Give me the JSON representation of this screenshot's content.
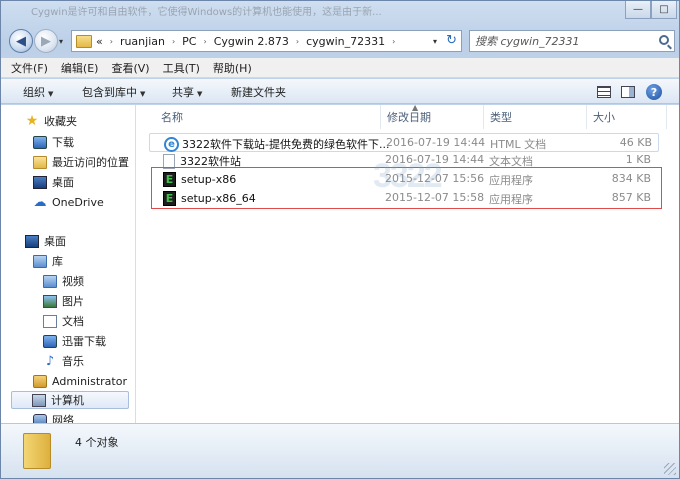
{
  "window": {
    "title_ghost": "Cygwin是许可和自由软件，它使得Windows的计算机也能使用，这是由于新...",
    "minimize_glyph": "—",
    "maximize_glyph": "□"
  },
  "address": {
    "overflow": "«",
    "breadcrumbs": [
      "ruanjian",
      "PC",
      "Cygwin 2.873",
      "cygwin_72331"
    ],
    "separator": "›",
    "dropdown_glyph": "▾",
    "refresh_glyph": "↻"
  },
  "search": {
    "placeholder": "搜索 cygwin_72331"
  },
  "nav_buttons": {
    "back_glyph": "◀",
    "forward_glyph": "▶",
    "history_glyph": "▾"
  },
  "menu": [
    "文件(F)",
    "编辑(E)",
    "查看(V)",
    "工具(T)",
    "帮助(H)"
  ],
  "toolbar": {
    "organize": "组织",
    "include_in_library": "包含到库中",
    "share": "共享",
    "new_folder": "新建文件夹",
    "dropdown_glyph": "▼",
    "help_glyph": "?"
  },
  "navpane": {
    "favorites": "收藏夹",
    "downloads": "下载",
    "recent": "最近访问的位置",
    "desktop_fav": "桌面",
    "onedrive": "OneDrive",
    "desktop": "桌面",
    "libraries": "库",
    "videos": "视频",
    "pictures": "图片",
    "documents": "文档",
    "thunder": "迅雷下载",
    "music": "音乐",
    "administrator": "Administrator",
    "computer": "计算机",
    "network": "网络"
  },
  "columns": {
    "name": "名称",
    "date": "修改日期",
    "type": "类型",
    "size": "大小",
    "sort_glyph": "▲"
  },
  "files": [
    {
      "name": "3322软件下载站-提供免费的绿色软件下...",
      "date": "2016-07-19 14:44",
      "type": "HTML 文档",
      "size": "46 KB",
      "icon": "ie-icon"
    },
    {
      "name": "3322软件站",
      "date": "2016-07-19 14:44",
      "type": "文本文档",
      "size": "1 KB",
      "icon": "text-file-icon"
    },
    {
      "name": "setup-x86",
      "date": "2015-12-07 15:56",
      "type": "应用程序",
      "size": "834 KB",
      "icon": "cygwin-exe-icon"
    },
    {
      "name": "setup-x86_64",
      "date": "2015-12-07 15:58",
      "type": "应用程序",
      "size": "857 KB",
      "icon": "cygwin-exe-icon"
    }
  ],
  "watermark": "3322",
  "status": {
    "count": "4 个对象"
  },
  "colors": {
    "highlight_box": "#e04a4a",
    "accent": "#2a6bc4"
  }
}
